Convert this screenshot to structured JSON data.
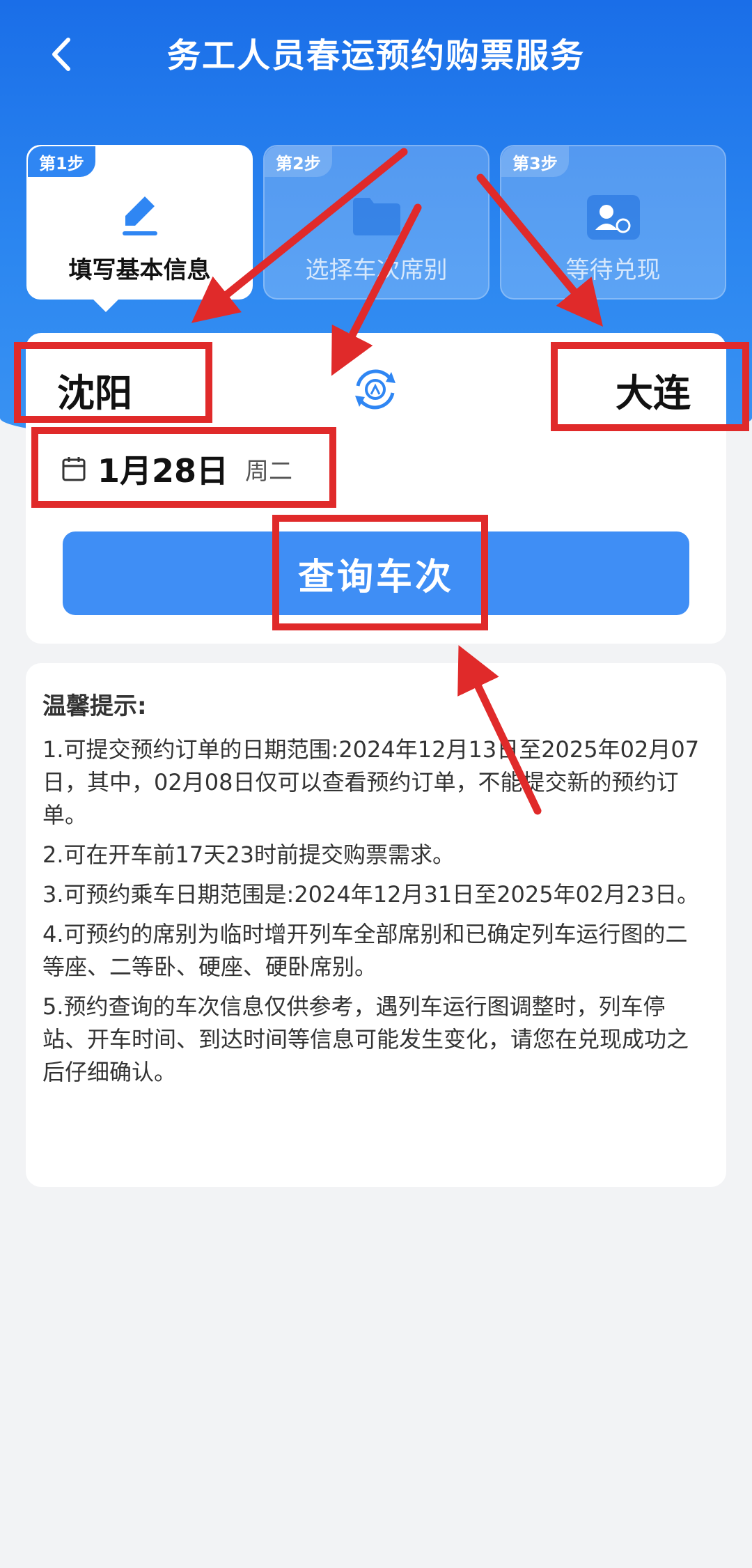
{
  "header": {
    "title": "务工人员春运预约购票服务"
  },
  "steps": [
    {
      "badge": "第1步",
      "label": "填写基本信息",
      "icon": "pencil-icon",
      "active": true
    },
    {
      "badge": "第2步",
      "label": "选择车次席别",
      "icon": "folder-icon",
      "active": false
    },
    {
      "badge": "第3步",
      "label": "等待兑现",
      "icon": "person-clock-icon",
      "active": false
    }
  ],
  "route": {
    "from": "沈阳",
    "to": "大连"
  },
  "date": {
    "value": "1月28日",
    "weekday": "周二"
  },
  "query_button": "查询车次",
  "tips": {
    "title": "温馨提示:",
    "items": [
      "1.可提交预约订单的日期范围:2024年12月13日至2025年02月07日，其中，02月08日仅可以查看预约订单，不能提交新的预约订单。",
      "2.可在开车前17天23时前提交购票需求。",
      "3.可预约乘车日期范围是:2024年12月31日至2025年02月23日。",
      "4.可预约的席别为临时增开列车全部席别和已确定列车运行图的二等座、二等卧、硬座、硬卧席别。",
      "5.预约查询的车次信息仅供参考，遇列车运行图调整时，列车停站、开车时间、到达时间等信息可能发生变化，请您在兑现成功之后仔细确认。"
    ]
  },
  "colors": {
    "primary": "#1a6ee8",
    "button": "#3f8ef5",
    "annotation": "#e02a2a"
  }
}
